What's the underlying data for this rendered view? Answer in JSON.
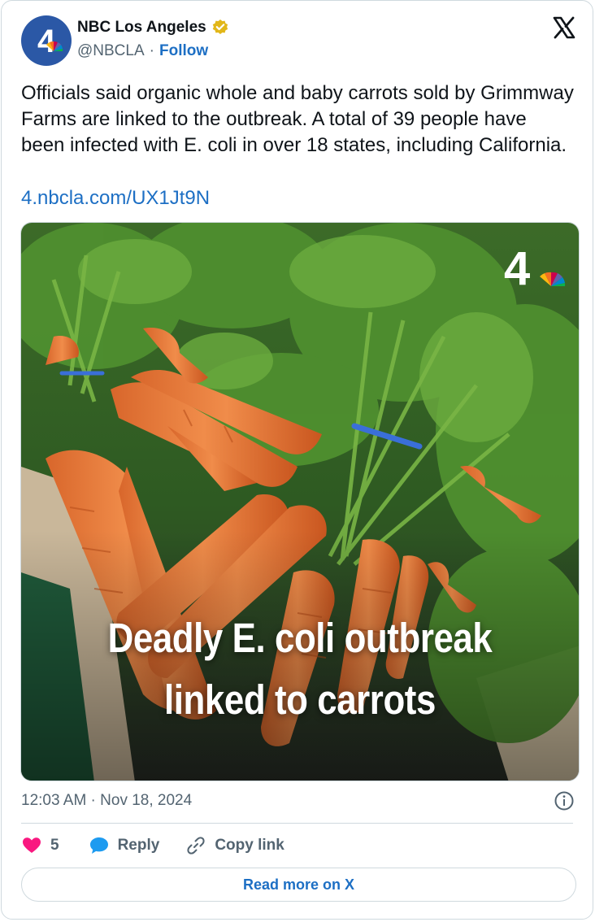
{
  "author": {
    "name": "NBC Los Angeles",
    "handle": "@NBCLA",
    "separator": "·",
    "follow_label": "Follow",
    "avatar_text": "4",
    "verified_badge_color": "#e2b719"
  },
  "tweet": {
    "text": "Officials said organic whole and baby carrots sold by Grimmway Farms are linked to the outbreak. A total of 39 people have been infected with E. coli in over 18 states, including California.",
    "link": "4.nbcla.com/UX1Jt9N"
  },
  "media": {
    "headline_line1": "Deadly E. coli outbreak",
    "headline_line2": "linked to carrots",
    "logo_text": "4"
  },
  "meta": {
    "timestamp": "12:03 AM · Nov 18, 2024"
  },
  "actions": {
    "like_count": "5",
    "reply_label": "Reply",
    "copy_label": "Copy link"
  },
  "read_more_label": "Read more on X",
  "colors": {
    "accent": "#1d6fc4",
    "like": "#f91880",
    "reply_icon": "#1d9bf0",
    "muted": "#536471",
    "border": "#cfd9de"
  }
}
